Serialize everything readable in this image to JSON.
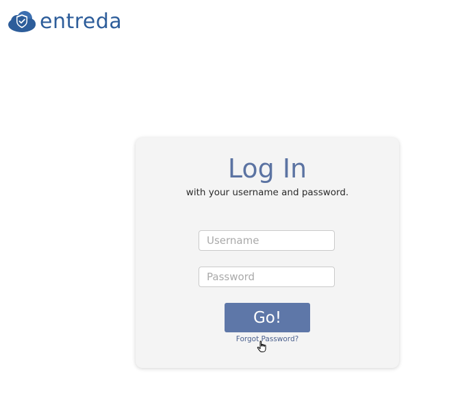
{
  "header": {
    "logo_text": "entreda",
    "logo_icon": "cloud-shield-icon"
  },
  "login": {
    "title": "Log In",
    "subtitle": "with your username and password.",
    "username_placeholder": "Username",
    "password_placeholder": "Password",
    "submit_label": "Go!",
    "forgot_label": "Forgot Password?"
  },
  "colors": {
    "brand": "#2d5d9a",
    "button": "#5e77a8",
    "title": "#5b73a2",
    "card_bg": "#f4f4f4"
  },
  "pointer": {
    "icon": "hand-pointer-icon"
  }
}
